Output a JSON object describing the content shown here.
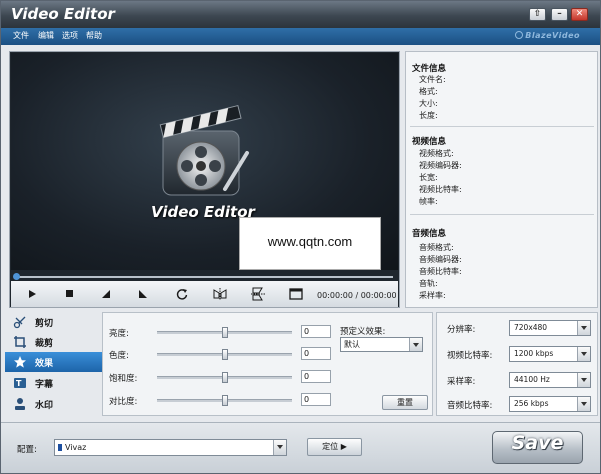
{
  "window": {
    "title": "Video Editor",
    "restore_glyph": "⇧",
    "minimize_glyph": "–",
    "close_glyph": "✕"
  },
  "menu": {
    "items": [
      "文件",
      "编辑",
      "选项",
      "帮助"
    ],
    "brand": "BlazeVideo"
  },
  "preview": {
    "splash_title": "Video Editor",
    "watermark_text": "www.qqtn.com",
    "time": "00:00:00 / 00:00:00",
    "controls": [
      "play-icon",
      "stop-icon",
      "prev-frame-icon",
      "next-frame-icon",
      "rotate-icon",
      "flip-horizontal-icon",
      "flip-vertical-icon",
      "fullscreen-icon"
    ],
    "seek_position": 0
  },
  "info": {
    "file_heading": "文件信息",
    "file_fields": [
      "文件名:",
      "格式:",
      "大小:",
      "长度:"
    ],
    "video_heading": "视频信息",
    "video_fields": [
      "视频格式:",
      "视频编码器:",
      "长宽:",
      "视频比特率:",
      "帧率:"
    ],
    "audio_heading": "音频信息",
    "audio_fields": [
      "音频格式:",
      "音频编码器:",
      "音频比特率:",
      "音轨:",
      "采样率:"
    ]
  },
  "tabs": [
    {
      "label": "剪切",
      "icon": "scissors-icon",
      "active": false
    },
    {
      "label": "裁剪",
      "icon": "crop-icon",
      "active": false
    },
    {
      "label": "效果",
      "icon": "star-icon",
      "active": true
    },
    {
      "label": "字幕",
      "icon": "subtitle-icon",
      "active": false
    },
    {
      "label": "水印",
      "icon": "watermark-icon",
      "active": false
    }
  ],
  "effects": {
    "sliders": [
      {
        "label": "亮度:",
        "value": "0",
        "level": 0.5
      },
      {
        "label": "色度:",
        "value": "0",
        "level": 0.5
      },
      {
        "label": "饱和度:",
        "value": "0",
        "level": 0.5
      },
      {
        "label": "对比度:",
        "value": "0",
        "level": 0.5
      }
    ],
    "preset_label": "预定义效果:",
    "preset_value": "默认",
    "reset_label": "重置"
  },
  "output": {
    "resolution_label": "分辨率:",
    "resolution_value": "720x480",
    "video_bitrate_label": "视频比特率:",
    "video_bitrate_value": "1200 kbps",
    "sample_rate_label": "采样率:",
    "sample_rate_value": "44100 Hz",
    "audio_bitrate_label": "音频比特率:",
    "audio_bitrate_value": "256 kbps"
  },
  "bottom": {
    "config_label": "配置:",
    "profile_value": "Vivaz",
    "locate_label": "定位",
    "locate_glyph": "▶",
    "save_label": "Save"
  }
}
